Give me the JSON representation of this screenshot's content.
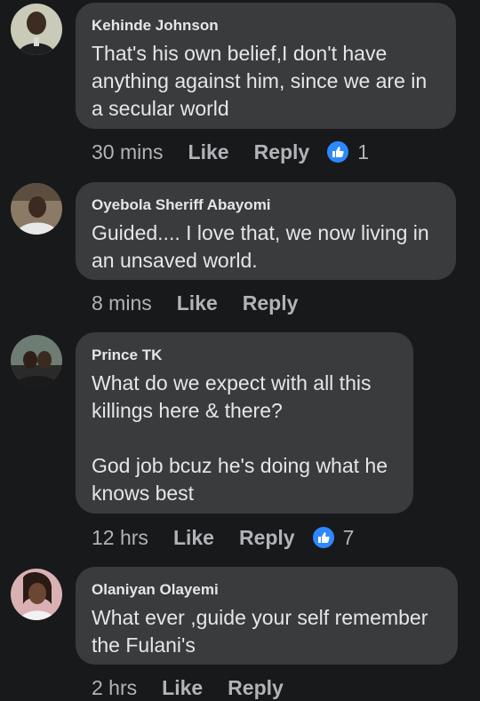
{
  "comments": [
    {
      "author": "Kehinde Johnson",
      "text": "That's his own belief,I don't have anything against him, since we are in a secular world",
      "time": "30 mins",
      "like_label": "Like",
      "reply_label": "Reply",
      "reaction_count": "1",
      "avatar_color": "#c9cbb8"
    },
    {
      "author": "Oyebola Sheriff Abayomi",
      "text": "Guided.... I love that, we now living in an unsaved world.",
      "time": "8 mins",
      "like_label": "Like",
      "reply_label": "Reply",
      "avatar_color": "#8a7a66"
    },
    {
      "author": "Prince TK",
      "text": "What do we expect with all this killings here & there?\n\nGod job bcuz he's doing what he knows best",
      "time": "12 hrs",
      "like_label": "Like",
      "reply_label": "Reply",
      "reaction_count": "7",
      "avatar_color": "#6e7d74"
    },
    {
      "author": "Olaniyan Olayemi",
      "text": "What ever  ,guide your self remember the Fulani's",
      "time": "2 hrs",
      "like_label": "Like",
      "reply_label": "Reply",
      "avatar_color": "#d9b0b4"
    }
  ],
  "colors": {
    "background": "#18191a",
    "bubble": "#3a3b3c",
    "text": "#e4e6eb",
    "meta": "#b0b3b8",
    "like_badge": "#2d88ff"
  },
  "icons": {
    "reaction": "thumbs-up-icon"
  }
}
